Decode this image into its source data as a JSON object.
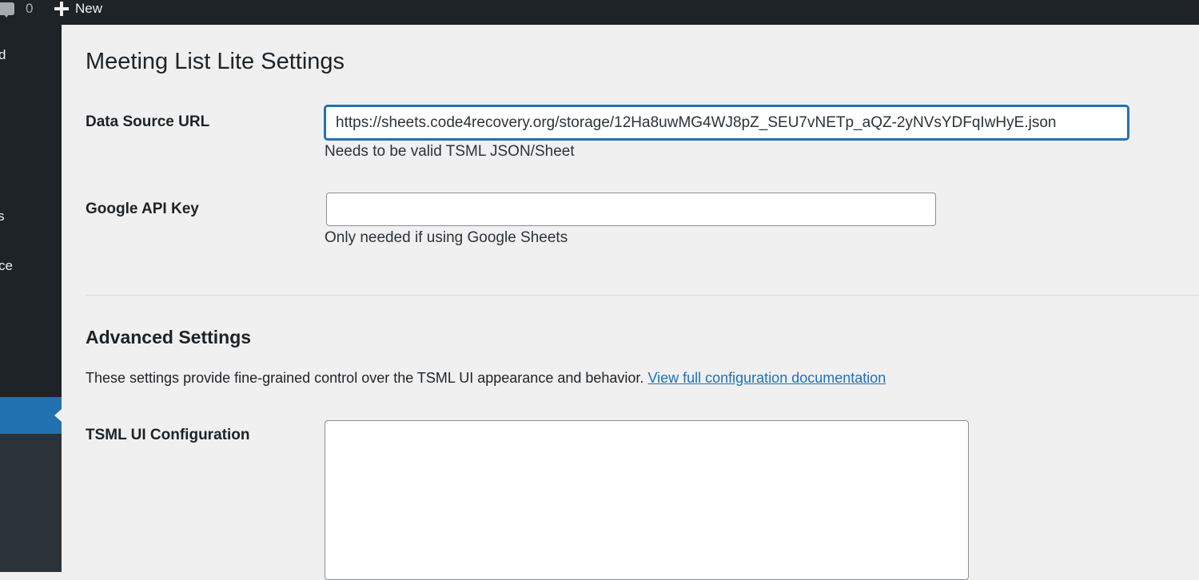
{
  "admin_bar": {
    "comments_count": "0",
    "new_label": "New"
  },
  "admin_menu": {
    "fragments": [
      "d",
      "s",
      "ce"
    ]
  },
  "page": {
    "title": "Meeting List Lite Settings"
  },
  "settings": {
    "data_source_url": {
      "label": "Data Source URL",
      "value": "https://sheets.code4recovery.org/storage/12Ha8uwMG4WJ8pZ_SEU7vNETp_aQZ-2yNVsYDFqIwHyE.json",
      "description": "Needs to be valid TSML JSON/Sheet"
    },
    "google_api_key": {
      "label": "Google API Key",
      "value": "",
      "description": "Only needed if using Google Sheets"
    }
  },
  "advanced": {
    "title": "Advanced Settings",
    "intro": "These settings provide fine-grained control over the TSML UI appearance and behavior.",
    "doc_link": "View full configuration documentation",
    "tsml_config": {
      "label": "TSML UI Configuration",
      "value": ""
    }
  },
  "colors": {
    "admin_bar_bg": "#1d2327",
    "accent": "#2271b1",
    "page_bg": "#f0f0f1"
  }
}
